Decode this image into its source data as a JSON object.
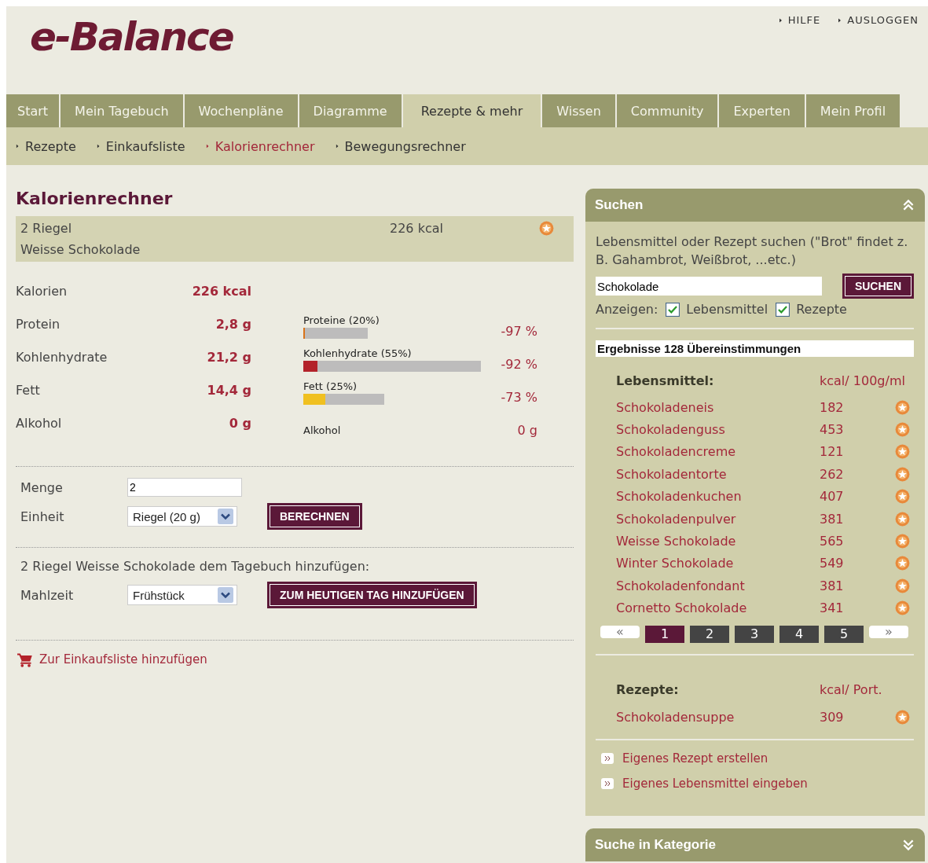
{
  "logo": "e-Balance",
  "top_links": [
    "HILFE",
    "AUSLOGGEN"
  ],
  "tabs": [
    {
      "label": "Start",
      "selected": false
    },
    {
      "label": "Mein Tagebuch",
      "selected": false
    },
    {
      "label": "Wochenpläne",
      "selected": false
    },
    {
      "label": "Diagramme",
      "selected": false
    },
    {
      "label": "Rezepte & mehr",
      "selected": true
    },
    {
      "label": "Wissen",
      "selected": false
    },
    {
      "label": "Community",
      "selected": false
    },
    {
      "label": "Experten",
      "selected": false
    },
    {
      "label": "Mein Profil",
      "selected": false
    }
  ],
  "subnav": [
    {
      "label": "Rezepte",
      "selected": false
    },
    {
      "label": "Einkaufsliste",
      "selected": false
    },
    {
      "label": "Kalorienrechner",
      "selected": true
    },
    {
      "label": "Bewegungsrechner",
      "selected": false
    }
  ],
  "calculator": {
    "title": "Kalorienrechner",
    "summary": {
      "amount": "2 Riegel",
      "kcal": "226 kcal",
      "food": "Weisse Schokolade"
    },
    "nutrients": [
      {
        "label": "Kalorien",
        "value": "226 kcal",
        "kind": "none"
      },
      {
        "label": "Protein",
        "value": "2,8 g",
        "kind": "bar",
        "bar_label": "Proteine (20%)",
        "level": 0.03,
        "color": "#d9731a",
        "percent": "-97 %"
      },
      {
        "label": "Kohlenhydrate",
        "value": "21,2 g",
        "kind": "bar",
        "bar_label": "Kohlenhydrate (55%)",
        "level": 0.08,
        "color": "#b3222a",
        "percent": "-92 %"
      },
      {
        "label": "Fett",
        "value": "14,4 g",
        "kind": "bar",
        "bar_label": "Fett (25%)",
        "level": 0.27,
        "color": "#f0c020",
        "percent": "-73 %"
      },
      {
        "label": "Alkohol",
        "value": "0 g",
        "kind": "text",
        "bar_label": "Alkohol",
        "percent": "0 g"
      }
    ],
    "quantity": {
      "label": "Menge",
      "value": "2"
    },
    "unit": {
      "label": "Einheit",
      "value": "Riegel (20 g)"
    },
    "calc_button": "BERECHNEN",
    "diary_text": "2 Riegel Weisse Schokolade dem Tagebuch hinzufügen:",
    "meal": {
      "label": "Mahlzeit",
      "value": "Frühstück"
    },
    "add_button": "ZUM HEUTIGEN TAG HINZUFÜGEN",
    "shopping_link": "Zur Einkaufsliste hinzufügen"
  },
  "search_panel": {
    "title": "Suchen",
    "hint": "Lebensmittel oder Rezept suchen (\"Brot\" findet z. B. Gahambrot, Weißbrot, ...etc.)",
    "query": "Schokolade",
    "button": "SUCHEN",
    "show_label": "Anzeigen:",
    "filters": [
      {
        "label": "Lebensmittel",
        "checked": true
      },
      {
        "label": "Rezepte",
        "checked": true
      }
    ],
    "results_title": "Ergebnisse 128 Übereinstimmungen",
    "foods_header": "Lebensmittel:",
    "foods_unit": "kcal/ 100g/ml",
    "foods": [
      {
        "name": "Schokoladeneis",
        "kcal": "182"
      },
      {
        "name": "Schokoladenguss",
        "kcal": "453"
      },
      {
        "name": "Schokoladencreme",
        "kcal": "121"
      },
      {
        "name": "Schokoladentorte",
        "kcal": "262"
      },
      {
        "name": "Schokoladenkuchen",
        "kcal": "407"
      },
      {
        "name": "Schokoladenpulver",
        "kcal": "381"
      },
      {
        "name": "Weisse Schokolade",
        "kcal": "565"
      },
      {
        "name": "Winter Schokolade",
        "kcal": "549"
      },
      {
        "name": "Schokoladenfondant",
        "kcal": "381"
      },
      {
        "name": "Cornetto Schokolade",
        "kcal": "341"
      }
    ],
    "pages": [
      {
        "label": "«",
        "kind": "arrow",
        "selected": false
      },
      {
        "label": "1",
        "kind": "page",
        "selected": true
      },
      {
        "label": "2",
        "kind": "page",
        "selected": false
      },
      {
        "label": "3",
        "kind": "page",
        "selected": false
      },
      {
        "label": "4",
        "kind": "page",
        "selected": false
      },
      {
        "label": "5",
        "kind": "page",
        "selected": false
      },
      {
        "label": "»",
        "kind": "arrow",
        "selected": false
      }
    ],
    "recipes_header": "Rezepte:",
    "recipes_unit": "kcal/ Port.",
    "recipes": [
      {
        "name": "Schokoladensuppe",
        "kcal": "309"
      }
    ],
    "links": [
      "Eigenes Rezept erstellen",
      "Eigenes Lebensmittel eingeben"
    ]
  },
  "category_panel": {
    "title": "Suche in Kategorie"
  }
}
